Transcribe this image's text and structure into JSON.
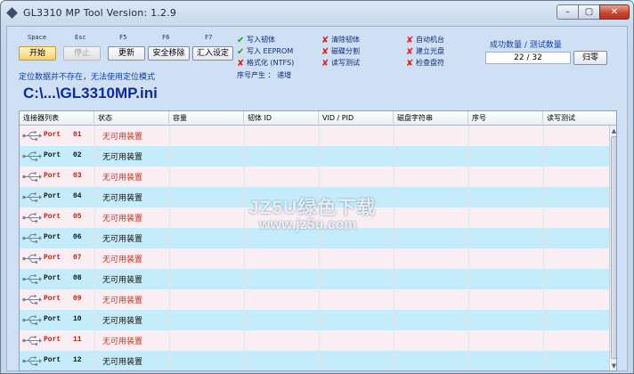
{
  "window": {
    "title": "GL3310 MP Tool Version: 1.2.9",
    "controls": {
      "minimize": "–",
      "maximize": "▢",
      "close": "✕"
    }
  },
  "toolbar": {
    "keys": [
      "Space",
      "Esc",
      "F5",
      "F6",
      "F7"
    ],
    "start_label": "开始",
    "stop_label": "停止",
    "update_label": "更新",
    "safe_remove_label": "安全移除",
    "import_settings_label": "汇入设定"
  },
  "status": {
    "message": "定位数据并不存在，无法使用定位模式",
    "ini_path": "C:\\...\\GL3310MP.ini"
  },
  "options": [
    {
      "label": "写入韧体",
      "state": "checked"
    },
    {
      "label": "写入 EEPROM",
      "state": "checked"
    },
    {
      "label": "格式化 (NTFS)",
      "state": "unchecked"
    },
    {
      "label": "清除韧体",
      "state": "unchecked"
    },
    {
      "label": "磁碟分割",
      "state": "unchecked"
    },
    {
      "label": "读写测试",
      "state": "unchecked"
    },
    {
      "label": "自动机台",
      "state": "unchecked"
    },
    {
      "label": "建立光盘",
      "state": "unchecked"
    },
    {
      "label": "检查盘符",
      "state": "unchecked"
    }
  ],
  "serial": {
    "text": "序号产生 ： 递增"
  },
  "counter": {
    "label": "成功数量 / 测试数量",
    "value": "22 / 32",
    "reset_label": "归零"
  },
  "table": {
    "columns": [
      "连接器列表",
      "状态",
      "容量",
      "韧体 ID",
      "VID / PID",
      "磁盘字符串",
      "序号",
      "读写测试"
    ],
    "rows": [
      {
        "port": "Port",
        "num": "01",
        "status": "无可用装置"
      },
      {
        "port": "Port",
        "num": "02",
        "status": "无可用装置"
      },
      {
        "port": "Port",
        "num": "03",
        "status": "无可用装置"
      },
      {
        "port": "Port",
        "num": "04",
        "status": "无可用装置"
      },
      {
        "port": "Port",
        "num": "05",
        "status": "无可用装置"
      },
      {
        "port": "Port",
        "num": "06",
        "status": "无可用装置"
      },
      {
        "port": "Port",
        "num": "07",
        "status": "无可用装置"
      },
      {
        "port": "Port",
        "num": "08",
        "status": "无可用装置"
      },
      {
        "port": "Port",
        "num": "09",
        "status": "无可用装置"
      },
      {
        "port": "Port",
        "num": "10",
        "status": "无可用装置"
      },
      {
        "port": "Port",
        "num": "11",
        "status": "无可用装置"
      },
      {
        "port": "Port",
        "num": "12",
        "status": "无可用装置"
      }
    ]
  },
  "watermark": {
    "line1": "JZ5U绿色下载",
    "line2": "www.jz5u.com"
  },
  "colors": {
    "accent": "#0c2a9e",
    "row_odd": "#fbeef2",
    "row_even": "#c4ecfb",
    "odd_text": "#b22016"
  }
}
